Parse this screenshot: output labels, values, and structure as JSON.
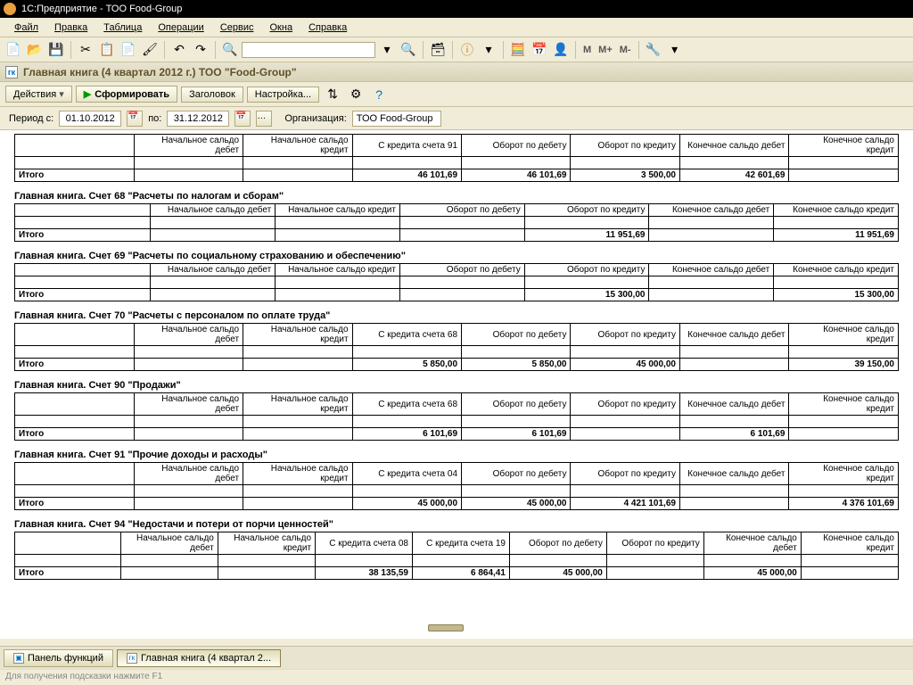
{
  "title": "1С:Предприятие - ТОО Food-Group",
  "menu": [
    "Файл",
    "Правка",
    "Таблица",
    "Операции",
    "Сервис",
    "Окна",
    "Справка"
  ],
  "doc_title": "Главная книга (4 квартал 2012 г.) ТОО \"Food-Group\"",
  "actions": {
    "actions_label": "Действия",
    "form": "Сформировать",
    "header": "Заголовок",
    "settings": "Настройка..."
  },
  "params": {
    "period_label": "Период с:",
    "date_from": "01.10.2012",
    "to_label": "по:",
    "date_to": "31.12.2012",
    "org_label": "Организация:",
    "org": "ТОО Food-Group"
  },
  "tb_text": {
    "m": "M",
    "mp": "M+",
    "mm": "M-"
  },
  "sections": [
    {
      "title": "",
      "headers": [
        "Начальное сальдо дебет",
        "Начальное сальдо кредит",
        "С кредита счета 91",
        "Оборот по дебету",
        "Оборот по кредиту",
        "Конечное сальдо дебет",
        "Конечное сальдо кредит"
      ],
      "total_label": "Итого",
      "values": [
        "",
        "",
        "46 101,69",
        "46 101,69",
        "3 500,00",
        "42 601,69",
        ""
      ]
    },
    {
      "title": "Главная книга. Счет 68 \"Расчеты по налогам и сборам\"",
      "headers": [
        "Начальное сальдо дебет",
        "Начальное сальдо кредит",
        "Оборот по дебету",
        "Оборот по кредиту",
        "Конечное сальдо дебет",
        "Конечное сальдо кредит"
      ],
      "total_label": "Итого",
      "values": [
        "",
        "",
        "",
        "11 951,69",
        "",
        "11 951,69"
      ]
    },
    {
      "title": "Главная книга. Счет 69 \"Расчеты по социальному страхованию и обеспечению\"",
      "headers": [
        "Начальное сальдо дебет",
        "Начальное сальдо кредит",
        "Оборот по дебету",
        "Оборот по кредиту",
        "Конечное сальдо дебет",
        "Конечное сальдо кредит"
      ],
      "total_label": "Итого",
      "values": [
        "",
        "",
        "",
        "15 300,00",
        "",
        "15 300,00"
      ]
    },
    {
      "title": "Главная книга. Счет 70 \"Расчеты с персоналом по оплате труда\"",
      "headers": [
        "Начальное сальдо дебет",
        "Начальное сальдо кредит",
        "С кредита счета 68",
        "Оборот по дебету",
        "Оборот по кредиту",
        "Конечное сальдо дебет",
        "Конечное сальдо кредит"
      ],
      "total_label": "Итого",
      "values": [
        "",
        "",
        "5 850,00",
        "5 850,00",
        "45 000,00",
        "",
        "39 150,00"
      ]
    },
    {
      "title": "Главная книга. Счет 90 \"Продажи\"",
      "headers": [
        "Начальное сальдо дебет",
        "Начальное сальдо кредит",
        "С кредита счета 68",
        "Оборот по дебету",
        "Оборот по кредиту",
        "Конечное сальдо дебет",
        "Конечное сальдо кредит"
      ],
      "total_label": "Итого",
      "values": [
        "",
        "",
        "6 101,69",
        "6 101,69",
        "",
        "6 101,69",
        ""
      ]
    },
    {
      "title": "Главная книга. Счет 91 \"Прочие доходы и расходы\"",
      "headers": [
        "Начальное сальдо дебет",
        "Начальное сальдо кредит",
        "С кредита счета 04",
        "Оборот по дебету",
        "Оборот по кредиту",
        "Конечное сальдо дебет",
        "Конечное сальдо кредит"
      ],
      "total_label": "Итого",
      "values": [
        "",
        "",
        "45 000,00",
        "45 000,00",
        "4 421 101,69",
        "",
        "4 376 101,69"
      ]
    },
    {
      "title": "Главная книга. Счет 94 \"Недостачи и потери от порчи ценностей\"",
      "headers": [
        "Начальное сальдо дебет",
        "Начальное сальдо кредит",
        "С кредита счета 08",
        "С кредита счета 19",
        "Оборот по дебету",
        "Оборот по кредиту",
        "Конечное сальдо дебет",
        "Конечное сальдо кредит"
      ],
      "total_label": "Итого",
      "values": [
        "",
        "",
        "38 135,59",
        "6 864,41",
        "45 000,00",
        "",
        "45 000,00",
        ""
      ]
    }
  ],
  "taskbar": {
    "panel": "Панель функций",
    "doc": "Главная книга (4 квартал 2..."
  },
  "hint": "Для получения подсказки нажмите F1"
}
